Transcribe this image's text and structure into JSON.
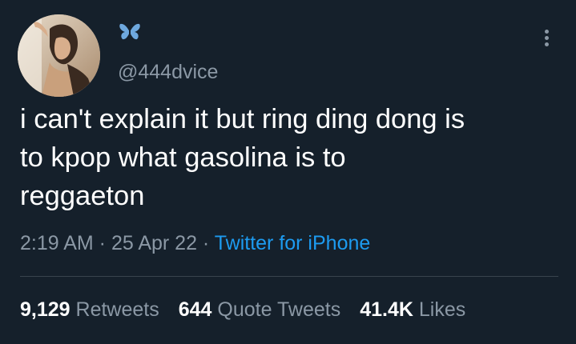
{
  "tweet": {
    "display_name_icon": "butterfly-icon",
    "handle": "@444dvice",
    "text": "i can't explain it but ring ding dong is\nto kpop what gasolina is to\nreggaeton",
    "time": "2:19 AM",
    "separator": " · ",
    "date": "25 Apr 22",
    "source": "Twitter for iPhone"
  },
  "stats": {
    "retweets_count": "9,129",
    "retweets_label": "Retweets",
    "quotes_count": "644",
    "quotes_label": "Quote Tweets",
    "likes_count": "41.4K",
    "likes_label": "Likes"
  },
  "colors": {
    "background": "#15202b",
    "text": "#ffffff",
    "secondary": "#8b98a5",
    "accent": "#1d9bf0",
    "divider": "#38444d"
  }
}
